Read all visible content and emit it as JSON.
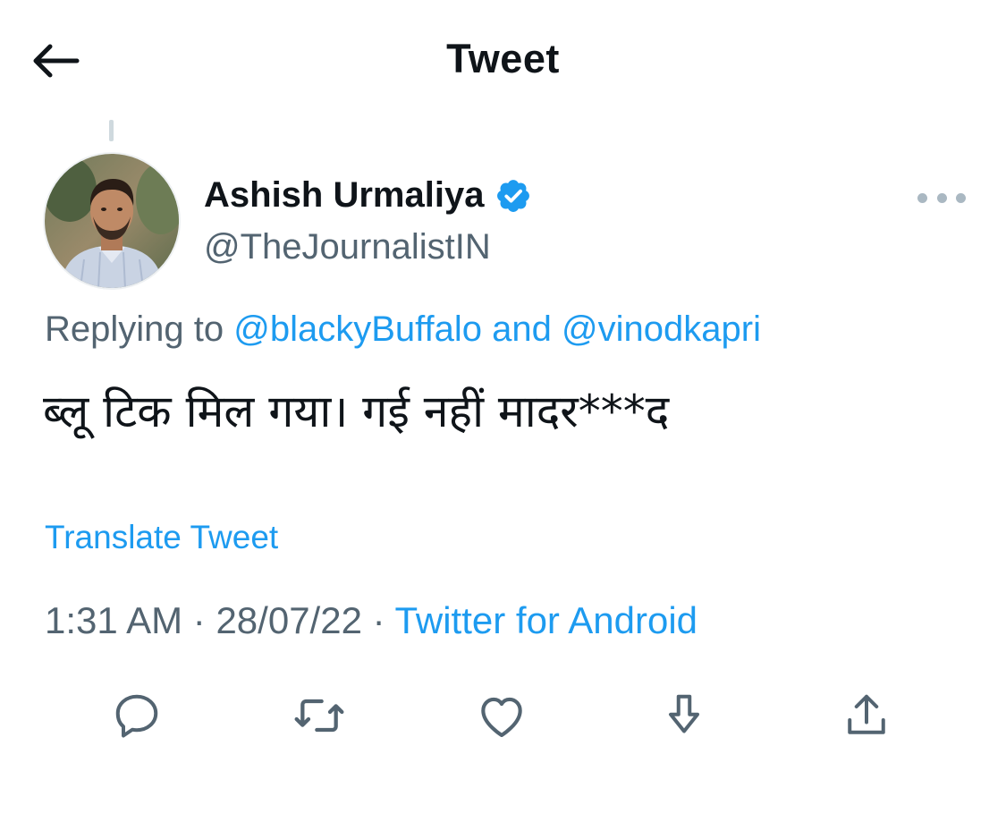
{
  "header": {
    "title": "Tweet",
    "back_icon": "arrow-left-icon"
  },
  "tweet": {
    "author": {
      "name": "Ashish Urmaliya",
      "handle": "@TheJournalistIN",
      "verified": true,
      "verified_icon": "verified-badge-icon"
    },
    "more_icon": "more-options-icon",
    "reply": {
      "prefix": "Replying to",
      "user1": "@blackyBuffalo",
      "connector": "and",
      "user2": "@vinodkapri"
    },
    "text": "ब्लू टिक मिल गया। गई नहीं मादर***द",
    "translate_label": "Translate Tweet",
    "time": "1:31 AM",
    "separator": "·",
    "date": "28/07/22",
    "source": "Twitter for Android"
  },
  "actions": [
    {
      "name": "reply",
      "icon": "reply-icon"
    },
    {
      "name": "retweet",
      "icon": "retweet-icon"
    },
    {
      "name": "like",
      "icon": "heart-icon"
    },
    {
      "name": "download",
      "icon": "download-icon"
    },
    {
      "name": "share",
      "icon": "share-icon"
    }
  ],
  "colors": {
    "accent": "#1d9bf0",
    "text_primary": "#0f1419",
    "text_secondary": "#536471",
    "icon_gray": "#536471"
  }
}
